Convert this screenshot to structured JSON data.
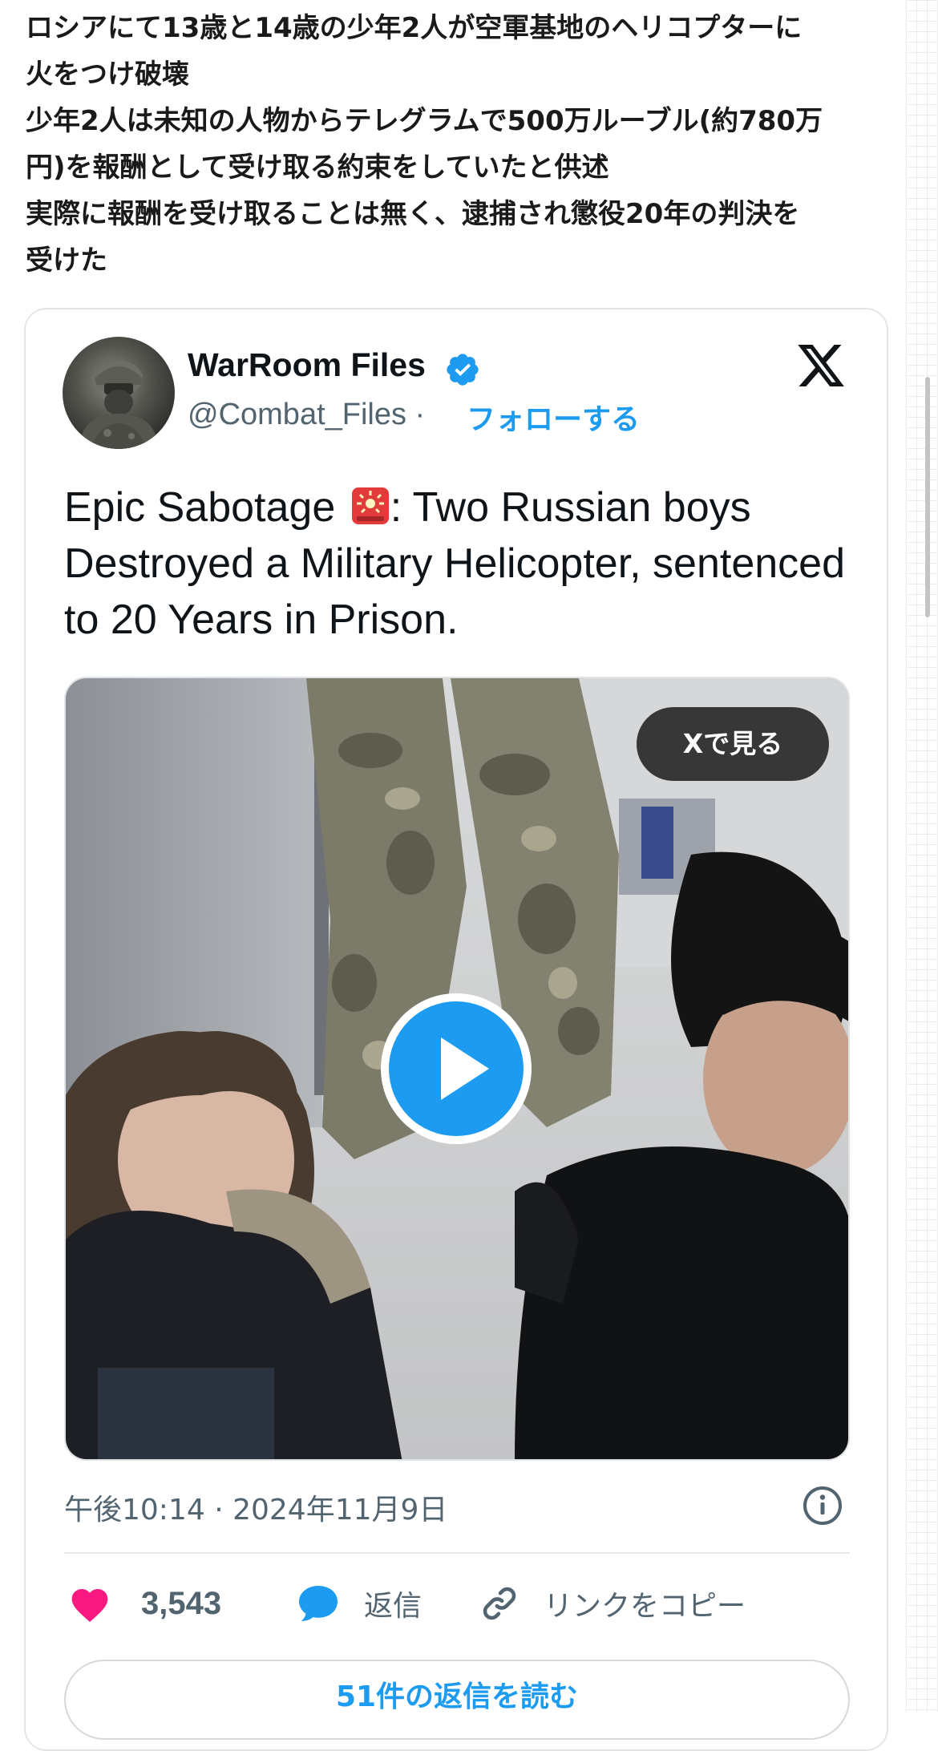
{
  "post": {
    "lines": [
      "ロシアにて13歳と14歳の少年2人が空軍基地のヘリコプターに",
      "火をつけ破壊",
      "少年2人は未知の人物からテレグラムで500万ルーブル(約780万",
      "円)を報酬として受け取る約束をしていたと供述",
      "実際に報酬を受け取ることは無く、逮捕され懲役20年の判決を",
      "受けた"
    ]
  },
  "tweet": {
    "author_name": "WarRoom Files",
    "author_handle": "@Combat_Files",
    "handle_separator": " · ",
    "follow_label": "フォローする",
    "text_before_emoji": "Epic Sabotage ",
    "text_after_emoji": ":  Two Russian boys Destroyed a Military Helicopter, sentenced to 20 Years in Prison.",
    "emoji": "police-car-light",
    "watch_on_x_label": "Xで見る",
    "timestamp": "午後10:14 · 2024年11月9日",
    "like_count": "3,543",
    "reply_label": "返信",
    "copy_link_label": "リンクをコピー",
    "read_replies_label": "51件の返信を読む"
  },
  "icons": {
    "verified": "verified-badge-icon",
    "x_logo": "x-logo-icon",
    "play": "play-icon",
    "info": "info-icon",
    "like": "heart-icon",
    "reply": "speech-bubble-icon",
    "link": "link-icon"
  },
  "colors": {
    "accent": "#1d9bf0",
    "like": "#f91880",
    "text": "#0f1419",
    "secondary_text": "#536471",
    "play_button": "#1d9bf0"
  }
}
